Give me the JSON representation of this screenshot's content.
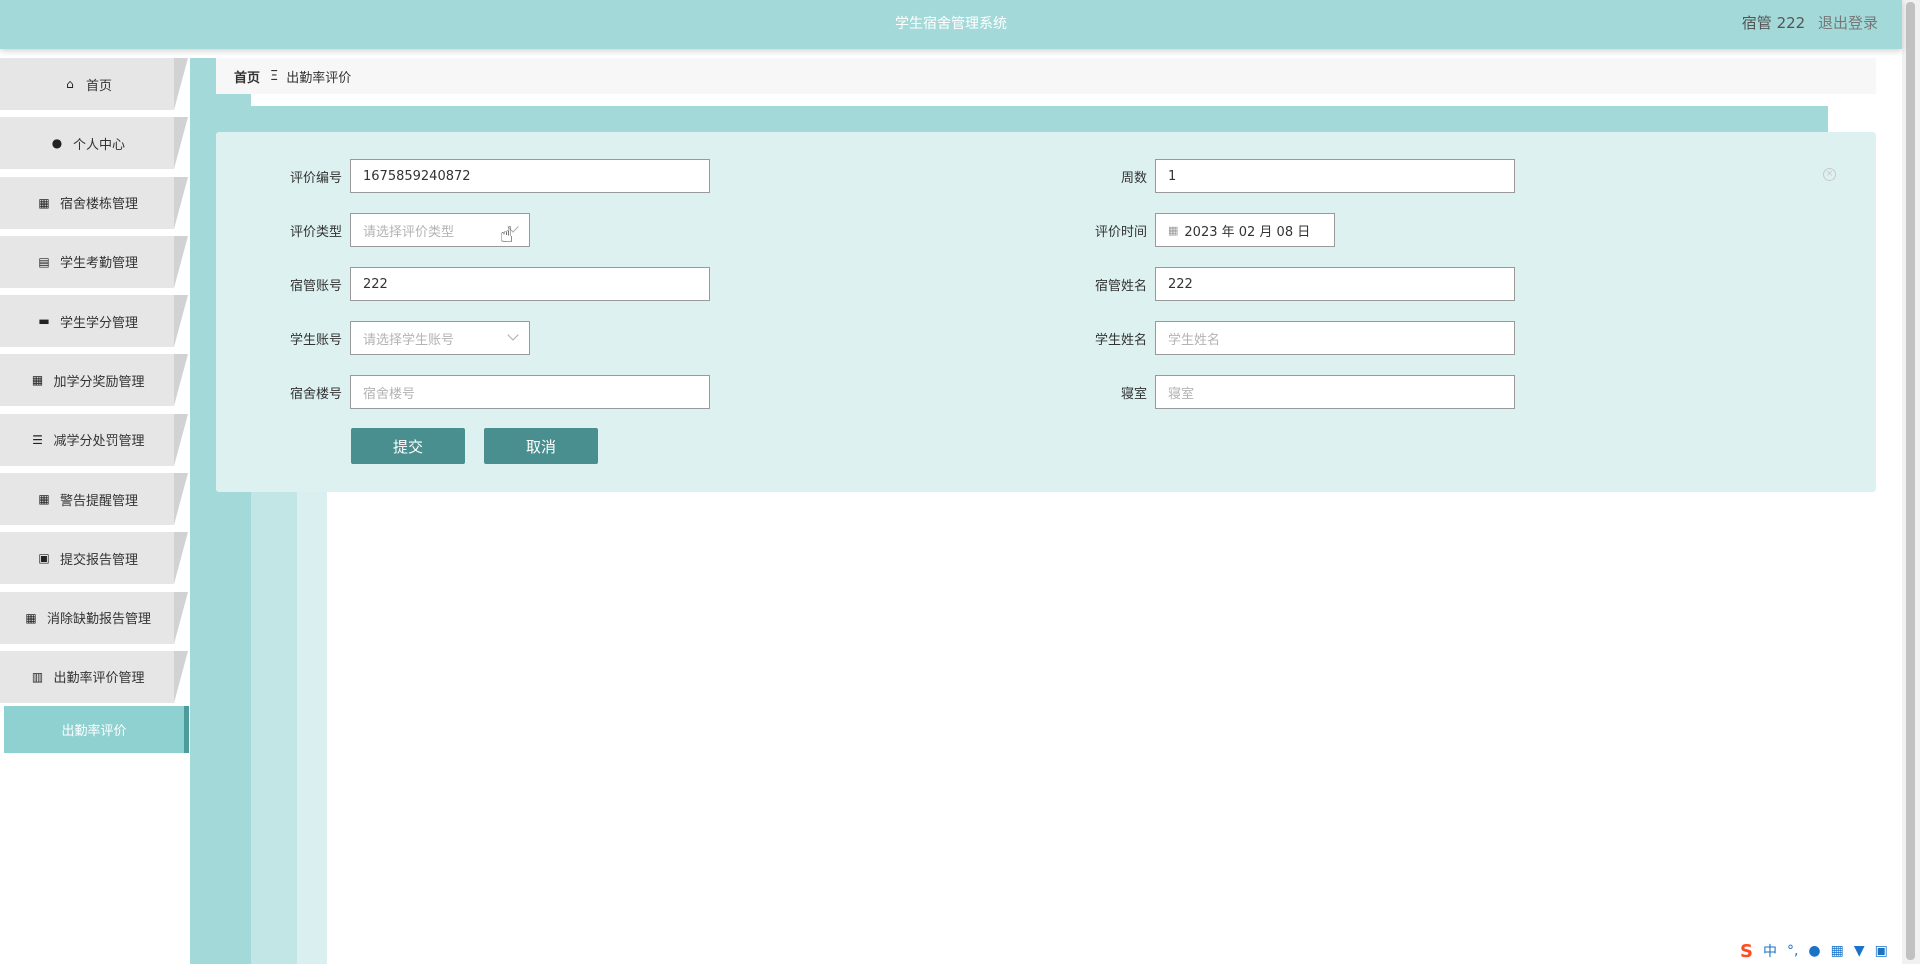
{
  "app": {
    "title": "学生宿舍管理系统",
    "user_label": "宿管 222",
    "logout_label": "退出登录"
  },
  "sidebar": {
    "items": [
      {
        "label": "首页",
        "icon": "home-icon"
      },
      {
        "label": "个人中心",
        "icon": "user-icon"
      },
      {
        "label": "宿舍楼栋管理",
        "icon": "grid-icon"
      },
      {
        "label": "学生考勤管理",
        "icon": "clipboard-icon"
      },
      {
        "label": "学生学分管理",
        "icon": "ticket-icon"
      },
      {
        "label": "加学分奖励管理",
        "icon": "grid-icon"
      },
      {
        "label": "减学分处罚管理",
        "icon": "list-icon"
      },
      {
        "label": "警告提醒管理",
        "icon": "grid-icon"
      },
      {
        "label": "提交报告管理",
        "icon": "briefcase-icon"
      },
      {
        "label": "消除缺勤报告管理",
        "icon": "grid-icon"
      },
      {
        "label": "出勤率评价管理",
        "icon": "clipboard-check-icon"
      }
    ],
    "active_sub": "出勤率评价"
  },
  "breadcrumb": {
    "home": "首页",
    "sep": "Ξ",
    "current": "出勤率评价"
  },
  "form": {
    "eval_no": {
      "label": "评价编号",
      "value": "1675859240872"
    },
    "weeks": {
      "label": "周数",
      "value": "1"
    },
    "eval_type": {
      "label": "评价类型",
      "placeholder": "请选择评价类型"
    },
    "eval_time": {
      "label": "评价时间",
      "value": "2023 年 02 月 08 日"
    },
    "manager_account": {
      "label": "宿管账号",
      "value": "222"
    },
    "manager_name": {
      "label": "宿管姓名",
      "value": "222"
    },
    "student_account": {
      "label": "学生账号",
      "placeholder": "请选择学生账号"
    },
    "student_name": {
      "label": "学生姓名",
      "placeholder": "学生姓名"
    },
    "building_no": {
      "label": "宿舍楼号",
      "placeholder": "宿舍楼号"
    },
    "room": {
      "label": "寝室",
      "placeholder": "寝室"
    },
    "submit_label": "提交",
    "cancel_label": "取消"
  },
  "ime": {
    "logo": "S",
    "lang": "中",
    "punct": "°,"
  },
  "colors": {
    "header_bg": "#a3d9d9",
    "panel_bg": "#ddf1f1",
    "button_bg": "#4a8f8f",
    "active_menu_bg": "#8fd0d0"
  }
}
